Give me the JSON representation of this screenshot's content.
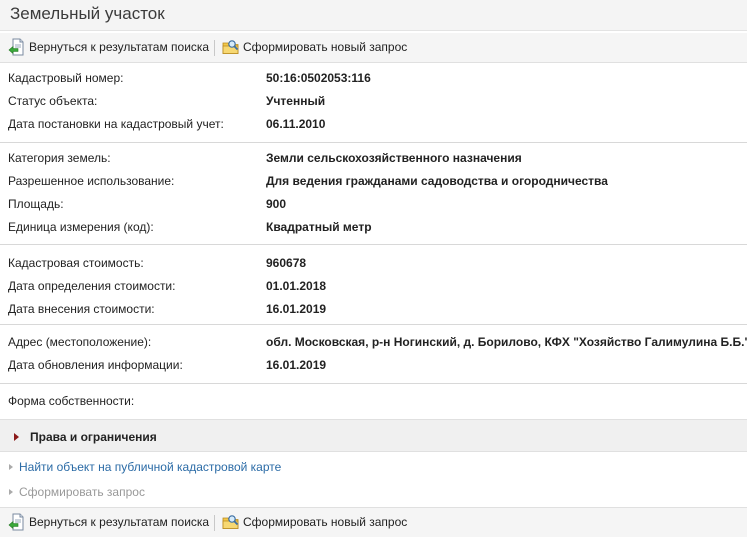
{
  "page": {
    "title": "Земельный участок"
  },
  "toolbar": {
    "back_label": "Вернуться к результатам поиска",
    "new_request_label": "Сформировать новый запрос"
  },
  "sections": [
    {
      "rows": [
        {
          "label": "Кадастровый номер:",
          "value": "50:16:0502053:116"
        },
        {
          "label": "Статус объекта:",
          "value": "Учтенный"
        },
        {
          "label": "Дата постановки на кадастровый учет:",
          "value": "06.11.2010"
        }
      ]
    },
    {
      "rows": [
        {
          "label": "Категория земель:",
          "value": "Земли сельскохозяйственного назначения"
        },
        {
          "label": "Разрешенное использование:",
          "value": "Для ведения гражданами садоводства и огородничества"
        },
        {
          "label": "Площадь:",
          "value": "900"
        },
        {
          "label": "Единица измерения (код):",
          "value": "Квадратный метр"
        }
      ]
    },
    {
      "rows": [
        {
          "label": "Кадастровая стоимость:",
          "value": "960678"
        },
        {
          "label": "Дата определения стоимости:",
          "value": "01.01.2018"
        },
        {
          "label": "Дата внесения стоимости:",
          "value": "16.01.2019"
        }
      ]
    },
    {
      "rows": [
        {
          "label": "Адрес (местоположение):",
          "value": "обл. Московская, р-н Ногинский, д. Борилово, КФХ \"Хозяйство Галимулина Б.Б.\""
        },
        {
          "label": "Дата обновления информации:",
          "value": "16.01.2019"
        }
      ]
    },
    {
      "rows": [
        {
          "label": "Форма собственности:",
          "value": ""
        }
      ]
    }
  ],
  "rights": {
    "label": "Права и ограничения"
  },
  "links": {
    "find_on_map": "Найти объект на публичной кадастровой карте",
    "make_request": "Сформировать запрос"
  }
}
